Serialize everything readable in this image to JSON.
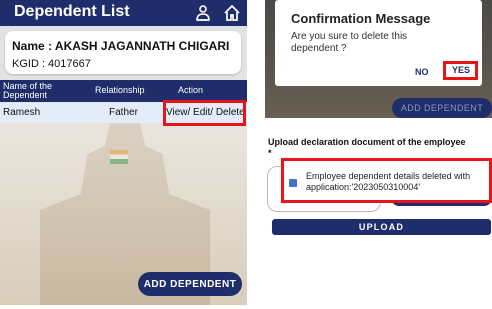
{
  "left": {
    "header": {
      "title": "Dependent List",
      "icons": [
        "person-icon",
        "home-icon"
      ]
    },
    "employee": {
      "name": "Name : AKASH JAGANNATH CHIGARI",
      "kgid": "KGID : 4017667"
    },
    "table": {
      "headers": {
        "name": "Name of the Dependent",
        "relationship": "Relationship",
        "action": "Action"
      },
      "rows": [
        {
          "name": "Ramesh",
          "relationship": "Father",
          "action": "View/ Edit/ Delete"
        }
      ]
    },
    "add_button": "ADD DEPENDENT"
  },
  "right": {
    "dialog": {
      "title": "Confirmation Message",
      "message": "Are you sure to delete this dependent ?",
      "no": "NO",
      "yes": "YES"
    },
    "add_button": "ADD DEPENDENT",
    "upload_section": {
      "title": "Upload declaration document of the employee",
      "required_mark": "*"
    },
    "toast": "Employee dependent details deleted with application:'2023050310004'",
    "upload_button": "UPLOAD"
  },
  "colors": {
    "primary": "#1f2d6b",
    "highlight": "#e8141a",
    "row_bg": "#e4ecfa"
  }
}
